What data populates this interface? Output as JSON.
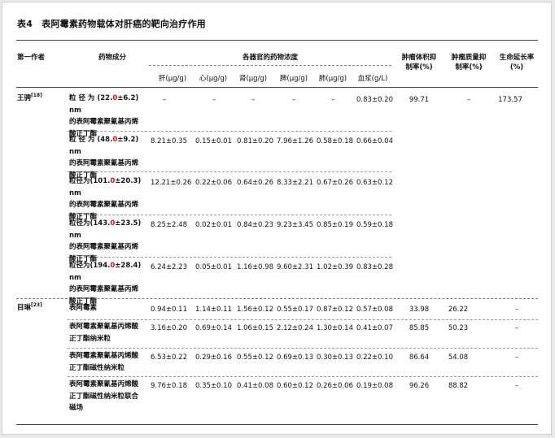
{
  "title": "表4　表阿霉素药物载体对肝癌的靶向治疗作用",
  "headers": {
    "author": "第一作者",
    "drug": "药物成分",
    "conc_group": "各器官的药物浓度",
    "conc": [
      "肝(μg/g)",
      "心(μg/g)",
      "肾(μg/g)",
      "脾(μg/g)",
      "肺(μg/g)",
      "血浆(g/L)"
    ],
    "tumor_vol": [
      "肿瘤体积抑",
      "制率(%)"
    ],
    "tumor_mass": [
      "肿瘤质量抑",
      "制率(%)"
    ],
    "survival": [
      "生命延长率",
      "(%)"
    ]
  },
  "groups": [
    {
      "author": "王骋",
      "ref": "[18]",
      "tumor_vol": "99.71",
      "tumor_mass": "–",
      "survival": "173.57",
      "rows": [
        {
          "drug_prefix": "粒 径 为 (22.",
          "drug_red": "0",
          "drug_suffix": "±6.2)  nm",
          "drug_rest": [
            "的表阿霉素聚氰基丙烯",
            "酸正丁酯"
          ],
          "conc": [
            "–",
            "–",
            "–",
            "–",
            "–",
            "0.83±0.20"
          ]
        },
        {
          "drug_prefix": "粒 径 为 (48.",
          "drug_red": "0",
          "drug_suffix": "±9.2)  nm",
          "drug_rest": [
            "的表阿霉素聚氰基丙烯",
            "酸正丁酯"
          ],
          "conc": [
            "8.21±0.35",
            "0.15±0.01",
            "0.81±0.20",
            "7.96±1.26",
            "0.58±0.18",
            "0.66±0.04"
          ]
        },
        {
          "drug_prefix": "粒径为(101.",
          "drug_red": "0",
          "drug_suffix": "±20.3) nm",
          "drug_rest": [
            "的表阿霉素聚氰基丙烯",
            "酸正丁酯"
          ],
          "conc": [
            "12.21±0.26",
            "0.22±0.06",
            "0.64±0.26",
            "8.33±2.21",
            "0.67±0.26",
            "0.63±0.12"
          ]
        },
        {
          "drug_prefix": "粒径为(143.",
          "drug_red": "0",
          "drug_suffix": "±23.5) nm",
          "drug_rest": [
            "的表阿霉素聚氰基丙烯",
            "酸正丁酯"
          ],
          "conc": [
            "8.25±2.48",
            "0.02±0.01",
            "0.84±0.23",
            "9.23±3.45",
            "0.85±0.19",
            "0.59±0.18"
          ]
        },
        {
          "drug_prefix": "粒径为(194.",
          "drug_red": "0",
          "drug_suffix": "±28.4) nm",
          "drug_rest": [
            "的表阿霉素聚氰基丙烯",
            "酸正丁酯"
          ],
          "conc": [
            "6.24±2.23",
            "0.05±0.01",
            "1.16±0.98",
            "9.60±2.31",
            "1.02±0.39",
            "0.83±0.28"
          ]
        }
      ]
    },
    {
      "author": "目琳",
      "ref": "[23]",
      "rows": [
        {
          "drug_lines": [
            "表阿霉素"
          ],
          "conc": [
            "0.94±0.11",
            "1.14±0.11",
            "1.56±0.12",
            "0.55±0.17",
            "0.87±0.12",
            "0.57±0.08"
          ],
          "tumor_vol": "33.98",
          "tumor_mass": "26.22",
          "survival": "–"
        },
        {
          "drug_lines": [
            "表阿霉素聚氰基丙烯酸",
            "正丁酯纳米粒"
          ],
          "conc": [
            "3.16±0.20",
            "0.69±0.14",
            "1.06±0.15",
            "2.12±0.24",
            "1.30±0.14",
            "0.41±0.07"
          ],
          "tumor_vol": "85.85",
          "tumor_mass": "50.23",
          "survival": "–"
        },
        {
          "drug_lines": [
            "表阿霉素聚氰基丙烯酸",
            "正丁酯磁性纳米粒"
          ],
          "conc": [
            "6.53±0.22",
            "0.29±0.16",
            "0.55±0.12",
            "0.69±0.13",
            "0.30±0.13",
            "0.22±0.10"
          ],
          "tumor_vol": "86.64",
          "tumor_mass": "54.08",
          "survival": "–"
        },
        {
          "drug_lines": [
            "表阿霉素聚氰基丙烯酸",
            "正丁酯磁性纳米粒联合",
            "磁场"
          ],
          "conc": [
            "9.76±0.18",
            "0.35±0.10",
            "0.41±0.08",
            "0.60±0.12",
            "0.26±0.06",
            "0.19±0.08"
          ],
          "tumor_vol": "96.26",
          "tumor_mass": "88.82",
          "survival": "–"
        }
      ]
    }
  ]
}
